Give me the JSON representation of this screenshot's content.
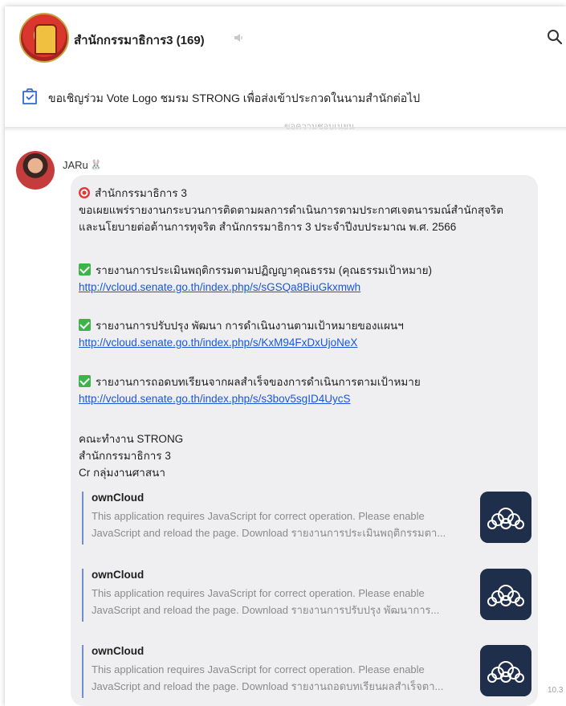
{
  "header": {
    "title": "สำนักกรรมาธิการ3 (169)",
    "mute_icon": "mute-icon",
    "search_icon": "search-icon"
  },
  "pinned": {
    "icon": "checkbox-icon",
    "text": "ขอเชิญร่วม Vote Logo ชมรม STRONG เพื่อส่งเข้าประกวดในนามสำนักต่อไป",
    "peek": "ขอความชอบเนยน"
  },
  "message": {
    "sender": "JARu",
    "sender_emoji": "🐰",
    "heading": "สำนักกรรมาธิการ 3",
    "intro_1": "ขอเผยแพร่รายงานกระบวนการติดตามผลการดำเนินการตามประกาศเจตนารมณ์สำนักสุจริต",
    "intro_2": "และนโยบายต่อต้านการทุจริต สำนักกรรมาธิการ 3 ประจำปีงบประมาณ พ.ศ. 2566",
    "items": [
      {
        "label": "รายงานการประเมินพฤติกรรมตามปฏิญญาคุณธรรม (คุณธรรมเป้าหมาย)",
        "url": "http://vcloud.senate.go.th/index.php/s/sGSQa8BiuGkxmwh"
      },
      {
        "label": "รายงานการปรับปรุง พัฒนา การดำเนินงานตามเป้าหมายของแผนฯ",
        "url": "http://vcloud.senate.go.th/index.php/s/KxM94FxDxUjoNeX"
      },
      {
        "label": "รายงานการถอดบทเรียนจากผลสำเร็จของการดำเนินการตามเป้าหมาย",
        "url": "http://vcloud.senate.go.th/index.php/s/s3bov5sgID4UycS"
      }
    ],
    "sign_1": "คณะทำงาน STRONG",
    "sign_2": "สำนักกรรมาธิการ 3",
    "sign_3": "Cr กลุ่มงานศาสนา",
    "previews": [
      {
        "title": "ownCloud",
        "line1": "This application requires JavaScript for correct operation. Please enable",
        "line2": "JavaScript and reload the page. Download รายงานการประเมินพฤติกรรมตา..."
      },
      {
        "title": "ownCloud",
        "line1": "This application requires JavaScript for correct operation. Please enable",
        "line2": "JavaScript and reload the page. Download รายงานการปรับปรุง พัฒนาการ..."
      },
      {
        "title": "ownCloud",
        "line1": "This application requires JavaScript for correct operation. Please enable",
        "line2": "JavaScript and reload the page. Download รายงานถอดบทเรียนผลสำเร็จตา..."
      }
    ],
    "time": "10.3"
  },
  "colors": {
    "link": "#1a57d6",
    "bubble": "#efeff1",
    "check": "#3bb54a",
    "owncloud_bg": "#1f2e4a"
  }
}
